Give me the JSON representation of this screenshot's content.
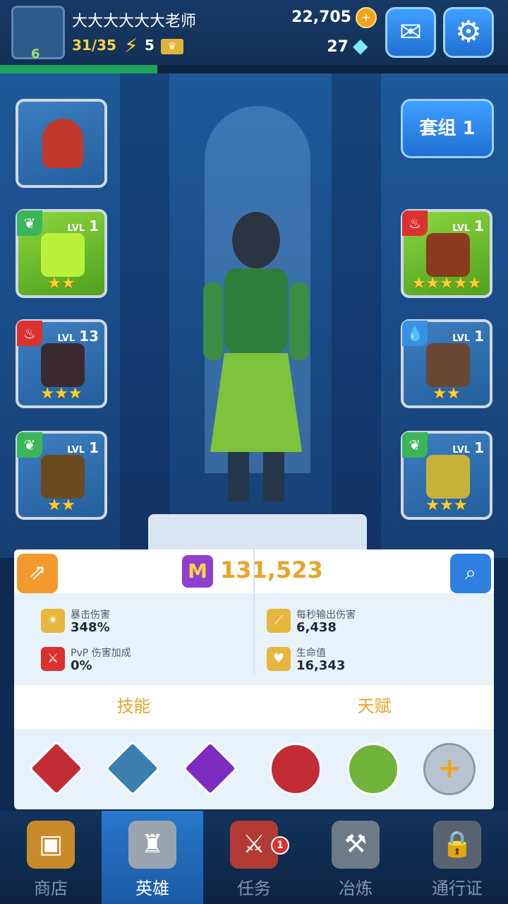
{
  "player": {
    "name": "大大大大大大老师",
    "level": "6",
    "energy": "31/35",
    "energy_bonus": "5",
    "coins": "22,705",
    "gems": "27",
    "xp_progress": 0.31
  },
  "deck_button": "套组 1",
  "equipment": {
    "pet": {
      "element": "",
      "level": "",
      "stars": ""
    },
    "left": [
      {
        "element": "nature",
        "lvl_label": "LVL",
        "level": "1",
        "stars": "★★"
      },
      {
        "element": "fire",
        "lvl_label": "LVL",
        "level": "13",
        "stars": "★★★"
      },
      {
        "element": "nature",
        "lvl_label": "LVL",
        "level": "1",
        "stars": "★★"
      }
    ],
    "right": [
      {
        "element": "fire",
        "lvl_label": "LVL",
        "level": "1",
        "stars": "★★★★★"
      },
      {
        "element": "water",
        "lvl_label": "LVL",
        "level": "1",
        "stars": "★★"
      },
      {
        "element": "nature",
        "lvl_label": "LVL",
        "level": "1",
        "stars": "★★★"
      }
    ]
  },
  "power": {
    "icon_letter": "M",
    "value": "131,523"
  },
  "stats": [
    {
      "label": "暴击伤害",
      "value": "348%"
    },
    {
      "label": "PvP 伤害加成",
      "value": "0%"
    },
    {
      "label": "每秒输出伤害",
      "value": "6,438"
    },
    {
      "label": "生命值",
      "value": "16,343"
    }
  ],
  "tabs": {
    "skills": "技能",
    "talents": "天赋"
  },
  "talent_add": "+",
  "nav": [
    {
      "label": "商店",
      "active": false
    },
    {
      "label": "英雄",
      "active": true
    },
    {
      "label": "任务",
      "active": false,
      "badge": "1"
    },
    {
      "label": "冶炼",
      "active": false
    },
    {
      "label": "通行证",
      "active": false
    }
  ],
  "colors": {
    "accent_gold": "#e8a52a",
    "primary_blue": "#2f7fde",
    "nature": "#3cb55a",
    "fire": "#d9322f",
    "water": "#3b8fe0"
  }
}
